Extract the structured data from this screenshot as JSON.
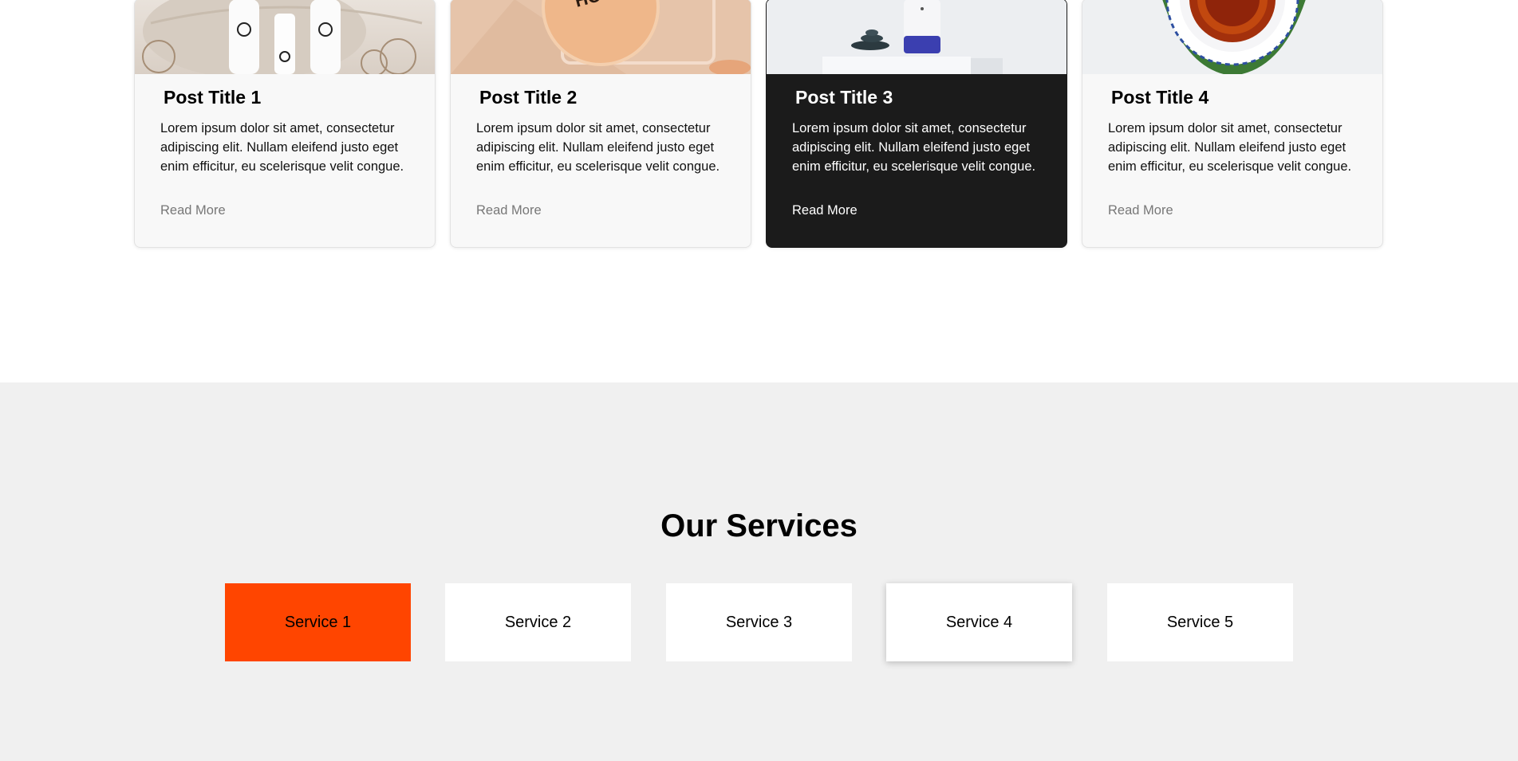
{
  "posts": [
    {
      "title": "Post Title 1",
      "excerpt": "Lorem ipsum dolor sit amet, consectetur adipiscing elit. Nullam eleifend justo eget enim efficitur, eu scelerisque velit congue.",
      "link": "Read More"
    },
    {
      "title": "Post Title 2",
      "excerpt": "Lorem ipsum dolor sit amet, consectetur adipiscing elit. Nullam eleifend justo eget enim efficitur, eu scelerisque velit congue.",
      "link": "Read More"
    },
    {
      "title": "Post Title 3",
      "excerpt": "Lorem ipsum dolor sit amet, consectetur adipiscing elit. Nullam eleifend justo eget enim efficitur, eu scelerisque velit congue.",
      "link": "Read More"
    },
    {
      "title": "Post Title 4",
      "excerpt": "Lorem ipsum dolor sit amet, consectetur adipiscing elit. Nullam eleifend justo eget enim efficitur, eu scelerisque velit congue.",
      "link": "Read More"
    }
  ],
  "services": {
    "heading": "Our Services",
    "items": [
      "Service 1",
      "Service 2",
      "Service 3",
      "Service 4",
      "Service 5"
    ]
  },
  "colors": {
    "accent": "#ff4500",
    "dark_card": "#1b1b1b",
    "section_bg": "#f0f0f0"
  }
}
